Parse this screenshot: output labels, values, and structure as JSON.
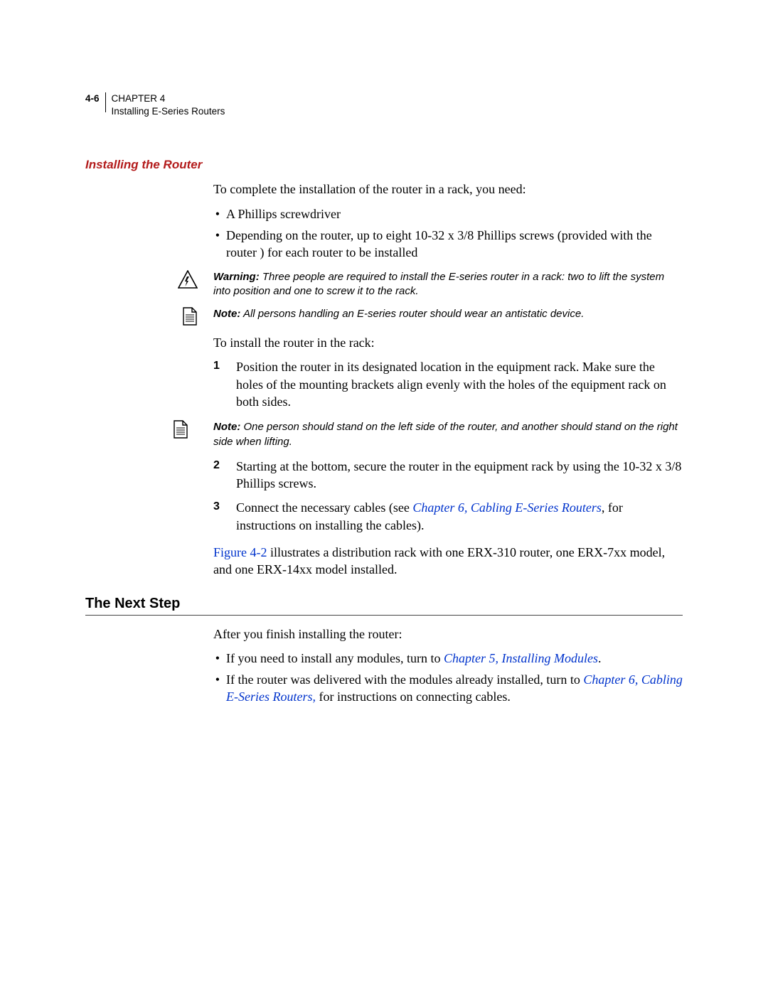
{
  "header": {
    "pagenum": "4-6",
    "chapter": "CHAPTER 4",
    "subtitle": "Installing E-Series Routers"
  },
  "section1": {
    "heading": "Installing the Router",
    "intro": "To complete the installation of the router in a rack, you need:",
    "bullets": [
      "A Phillips screwdriver",
      "Depending on the router, up to eight 10-32 x 3/8 Phillips screws (provided with the router ) for each router to be installed"
    ],
    "warning_label": "Warning:",
    "warning_text": " Three people are required to install the E-series router in a rack: two to lift the system into position and one to screw it to the rack.",
    "note1_label": "Note:",
    "note1_text": " All persons handling an E-series router should wear an antistatic device.",
    "install_lead": "To install the router in the rack:",
    "step1": "Position the router in its designated location in the equipment rack. Make sure the holes of the mounting brackets align evenly with the holes of the equipment rack on both sides.",
    "note2_label": "Note:",
    "note2_text": " One person should stand on the left side of the router, and another should stand on the right side when lifting.",
    "step2": "Starting at the bottom, secure the router in the equipment rack by using the 10-32 x 3/8 Phillips screws.",
    "step3_pre": "Connect the necessary cables (see ",
    "step3_link": "Chapter 6, Cabling E-Series Routers",
    "step3_post": ", for instructions on installing the cables).",
    "figref": "Figure 4-2",
    "figtext": " illustrates a distribution rack with one ERX-310 router, one ERX-7xx model, and one ERX-14xx model installed."
  },
  "section2": {
    "heading": "The Next Step",
    "intro": "After you finish installing the router:",
    "bullet1_pre": "If you need to install any modules, turn to ",
    "bullet1_link": "Chapter 5, Installing Modules",
    "bullet1_post": ".",
    "bullet2_pre": "If the router was delivered with the modules already installed, turn to ",
    "bullet2_link": "Chapter 6, Cabling E-Series Routers,",
    "bullet2_post": " for instructions on connecting cables."
  }
}
